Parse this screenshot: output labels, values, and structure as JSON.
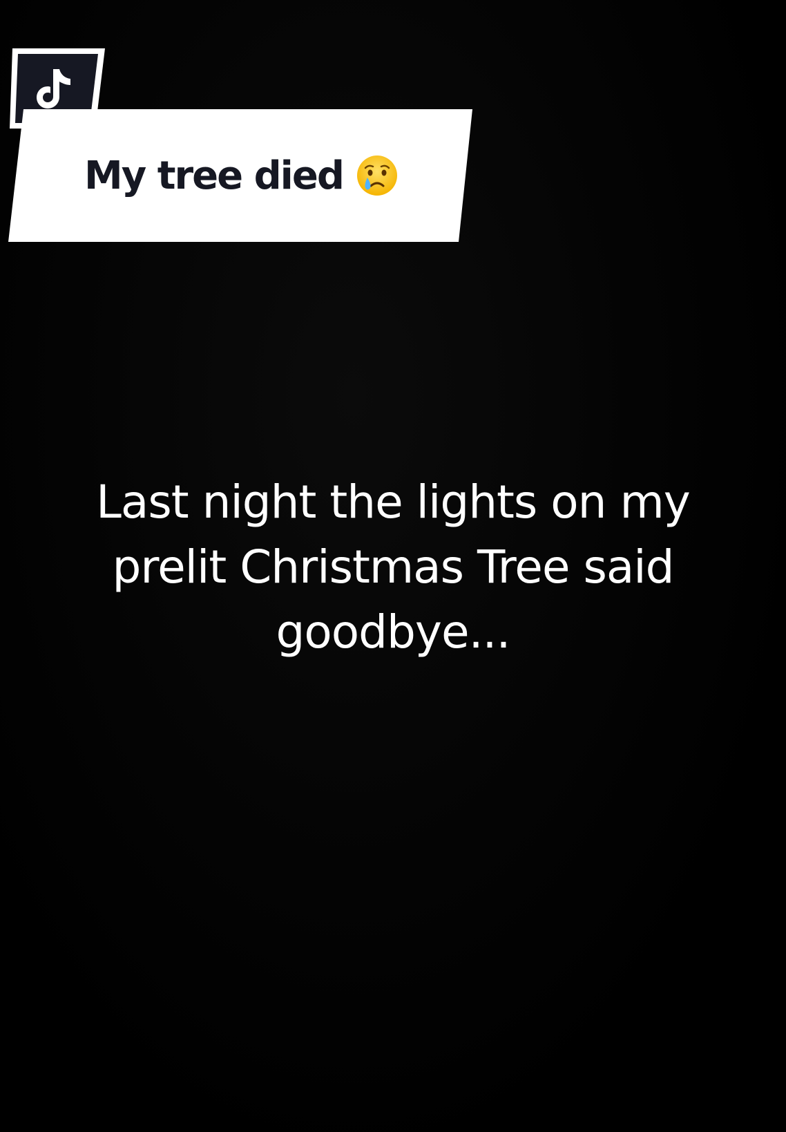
{
  "overlay": {
    "logo_icon": "tiktok-logo-icon",
    "title": "My tree died",
    "title_emoji_icon": "crying-face-icon",
    "colors": {
      "banner_bg": "#ffffff",
      "title_text": "#161823",
      "logo_bg": "#161823",
      "caption_text": "#ffffff",
      "background": "#000000"
    }
  },
  "caption": {
    "lines": [
      "Last night the lights on my",
      "prelit Christmas Tree said",
      "goodbye..."
    ]
  }
}
